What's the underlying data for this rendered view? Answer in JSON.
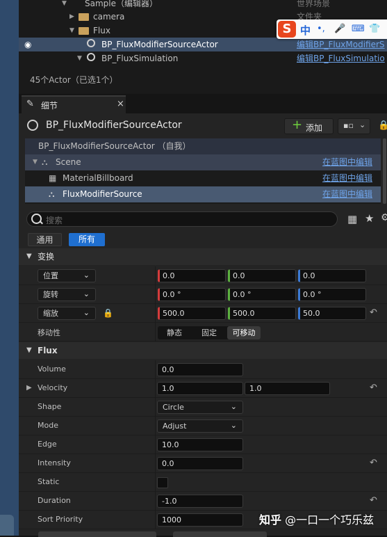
{
  "outliner": {
    "rows": [
      {
        "label": "Sample（编辑器）",
        "type": "世界场景"
      },
      {
        "label": "camera",
        "type": "文件夹"
      },
      {
        "label": "Flux",
        "type": ""
      },
      {
        "label": "BP_FluxModifierSourceActor",
        "type": "编辑BP_FluxModifierS"
      },
      {
        "label": "BP_FluxSimulation",
        "type": "编辑BP_FluxSimulatio"
      }
    ],
    "status": "45个Actor（已选1个）"
  },
  "ime": {
    "logo": "S",
    "mode": "中"
  },
  "details_tab": {
    "label": "细节",
    "close": "×"
  },
  "header": {
    "actor_name": "BP_FluxModifierSourceActor",
    "add_label": "添加",
    "add_icon": "plus-icon"
  },
  "components": [
    {
      "label": "BP_FluxModifierSourceActor （自我）",
      "edit": ""
    },
    {
      "label": "Scene",
      "edit": "在蓝图中编辑"
    },
    {
      "label": "MaterialBillboard",
      "edit": "在蓝图中编辑"
    },
    {
      "label": "FluxModifierSource",
      "edit": "在蓝图中编辑"
    }
  ],
  "search": {
    "placeholder": "搜索"
  },
  "filters": {
    "common": "通用",
    "all": "所有"
  },
  "transform": {
    "category": "变换",
    "location": {
      "label": "位置",
      "x": "0.0",
      "y": "0.0",
      "z": "0.0"
    },
    "rotation": {
      "label": "旋转",
      "x": "0.0 °",
      "y": "0.0 °",
      "z": "0.0 °"
    },
    "scale": {
      "label": "缩放",
      "x": "500.0",
      "y": "500.0",
      "z": "50.0"
    },
    "mobility": {
      "label": "移动性",
      "options": [
        "静态",
        "固定",
        "可移动"
      ],
      "selected": "可移动"
    }
  },
  "flux": {
    "category": "Flux",
    "volume": {
      "label": "Volume",
      "value": "0.0"
    },
    "velocity": {
      "label": "Velocity",
      "x": "1.0",
      "y": "1.0"
    },
    "shape": {
      "label": "Shape",
      "value": "Circle"
    },
    "mode": {
      "label": "Mode",
      "value": "Adjust"
    },
    "edge": {
      "label": "Edge",
      "value": "10.0"
    },
    "intensity": {
      "label": "Intensity",
      "value": "0.0"
    },
    "static": {
      "label": "Static",
      "checked": false
    },
    "duration": {
      "label": "Duration",
      "value": "-1.0"
    },
    "sort_priority": {
      "label": "Sort Priority",
      "value": "1000"
    }
  },
  "watermark": {
    "logo": "知乎",
    "text": "@一口一个巧乐兹"
  },
  "colors": {
    "accent": "#1f6fd0",
    "link": "#6ea3e8",
    "selected_row": "#495a72",
    "panel": "#242424"
  }
}
